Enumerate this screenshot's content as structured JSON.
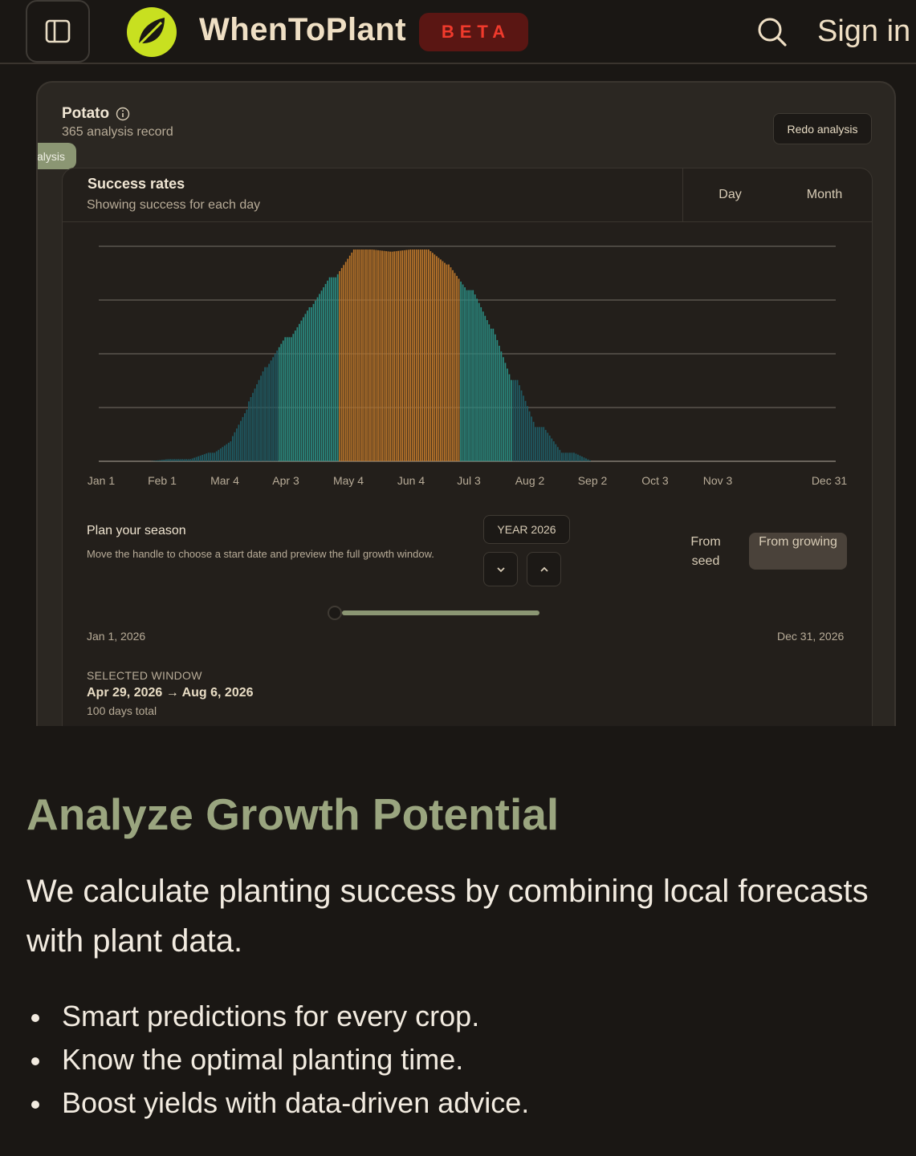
{
  "header": {
    "brand": "WhenToPlant",
    "badge": "BETA",
    "sign_in": "Sign in",
    "icons": {
      "sidebar": "sidebar-toggle-icon",
      "logo": "leaf-logo-icon",
      "search": "search-icon"
    }
  },
  "preview": {
    "crop_name": "Potato",
    "record_count": "365 analysis record",
    "redo_label": "Redo analysis",
    "analysis_tab": "nalysis",
    "rates_title": "Success rates",
    "rates_subtitle": "Showing success for each day",
    "toggle": {
      "day": "Day",
      "month": "Month"
    },
    "plan": {
      "title": "Plan your season",
      "description": "Move the handle to choose a start date and preview the full growth window.",
      "year_label": "YEAR 2026",
      "from_seed": "From seed",
      "from_growing": "From growing",
      "range_start": "Jan 1, 2026",
      "range_end": "Dec 31, 2026",
      "selected_label": "SELECTED WINDOW",
      "selected_range": "Apr 29, 2026 → Aug 6, 2026",
      "selected_days": "100 days total"
    }
  },
  "chart_data": {
    "type": "bar",
    "title": "Success rates",
    "x_tick_labels": [
      "Jan 1",
      "Feb 1",
      "Mar 4",
      "Apr 3",
      "May 4",
      "Jun 4",
      "Jul 3",
      "Aug 2",
      "Sep 2",
      "Oct 3",
      "Nov 3",
      "Dec 31"
    ],
    "days": 365,
    "ylim": [
      0,
      1
    ],
    "gridlines": 4,
    "series": [
      {
        "values_by_day_range": [
          {
            "from_day": 1,
            "to_day": 30,
            "value": 0.0
          },
          {
            "from_day": 31,
            "to_day": 50,
            "value": 0.01
          },
          {
            "from_day": 51,
            "to_day": 62,
            "value": 0.04
          },
          {
            "from_day": 63,
            "to_day": 70,
            "value": 0.1
          },
          {
            "from_day": 71,
            "to_day": 78,
            "value": 0.26
          },
          {
            "from_day": 79,
            "to_day": 88,
            "value": 0.44
          },
          {
            "from_day": 89,
            "to_day": 100,
            "value": 0.58
          },
          {
            "from_day": 101,
            "to_day": 110,
            "value": 0.72
          },
          {
            "from_day": 111,
            "to_day": 122,
            "value": 0.86
          },
          {
            "from_day": 123,
            "to_day": 140,
            "value": 0.99
          },
          {
            "from_day": 141,
            "to_day": 150,
            "value": 0.98
          },
          {
            "from_day": 151,
            "to_day": 168,
            "value": 0.99
          },
          {
            "from_day": 169,
            "to_day": 178,
            "value": 0.92
          },
          {
            "from_day": 179,
            "to_day": 190,
            "value": 0.8
          },
          {
            "from_day": 191,
            "to_day": 200,
            "value": 0.62
          },
          {
            "from_day": 201,
            "to_day": 212,
            "value": 0.38
          },
          {
            "from_day": 213,
            "to_day": 225,
            "value": 0.16
          },
          {
            "from_day": 226,
            "to_day": 240,
            "value": 0.04
          },
          {
            "from_day": 241,
            "to_day": 365,
            "value": 0.0
          }
        ]
      }
    ],
    "highlight": {
      "selected_window_color": "#b8742a",
      "near_window_color": "#2a8a80",
      "outside_color": "#1f5a63"
    }
  },
  "marketing": {
    "headline": "Analyze Growth Potential",
    "lead": "We calculate planting success by combining local forecasts with plant data.",
    "bullets": [
      "Smart predictions for every crop.",
      "Know the optimal planting time.",
      "Boost yields with data-driven advice."
    ]
  },
  "colors": {
    "background": "#1a1714",
    "accent": "#9aa57f",
    "beta_text": "#f03a2c",
    "beta_bg": "#5a1613",
    "logo": "#c8e020"
  }
}
